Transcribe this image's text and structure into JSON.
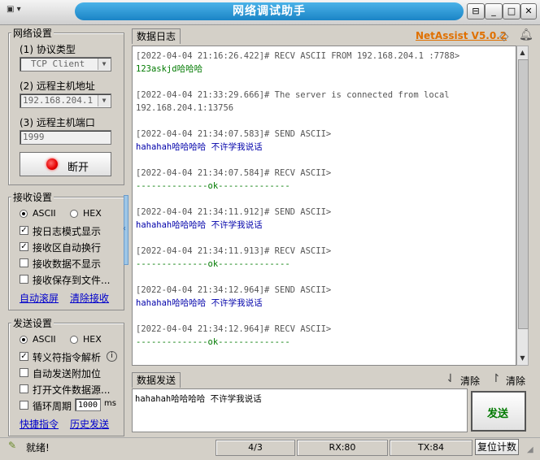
{
  "app": {
    "title": "网络调试助手",
    "brand": "NetAssist V5.0.2"
  },
  "colors": {
    "title_pill": "#2b98d6",
    "brand": "#e07000",
    "recv_text": "#007a00",
    "send_text": "#0000aa",
    "send_button": "#007a00",
    "led": "#e60000"
  },
  "network": {
    "group_title": "网络设置",
    "protocol_label": "(1) 协议类型",
    "protocol_value": "TCP Client",
    "host_label": "(2) 远程主机地址",
    "host_value": "192.168.204.1",
    "port_label": "(3) 远程主机端口",
    "port_value": "1999",
    "connect_button": "断开"
  },
  "recv_settings": {
    "group_title": "接收设置",
    "radio_ascii": "ASCII",
    "radio_hex": "HEX",
    "selected": "ASCII",
    "options": [
      {
        "label": "按日志模式显示",
        "checked": true
      },
      {
        "label": "接收区自动换行",
        "checked": true
      },
      {
        "label": "接收数据不显示",
        "checked": false
      },
      {
        "label": "接收保存到文件...",
        "checked": false
      }
    ],
    "link_autoscroll": "自动滚屏",
    "link_clear": "清除接收"
  },
  "send_settings": {
    "group_title": "发送设置",
    "radio_ascii": "ASCII",
    "radio_hex": "HEX",
    "selected": "ASCII",
    "options": [
      {
        "label": "转义符指令解析",
        "checked": true
      },
      {
        "label": "自动发送附加位",
        "checked": false
      },
      {
        "label": "打开文件数据源...",
        "checked": false
      },
      {
        "label": "循环周期",
        "checked": false
      }
    ],
    "cycle_value": "1000",
    "cycle_unit": "ms",
    "link_shortcut": "快捷指令",
    "link_history": "历史发送"
  },
  "log": {
    "tab": "数据日志",
    "entries": [
      {
        "meta": "[2022-04-04 21:16:26.422]# RECV ASCII FROM 192.168.204.1 :7788>",
        "body": "123askjd哈哈哈",
        "kind": "recv"
      },
      {
        "meta": "[2022-04-04 21:33:29.666]# The server is connected from local",
        "body": "192.168.204.1:13756",
        "kind": "meta"
      },
      {
        "meta": "[2022-04-04 21:34:07.583]# SEND ASCII>",
        "body": "hahahah哈哈哈哈 不许学我说话",
        "kind": "send"
      },
      {
        "meta": "[2022-04-04 21:34:07.584]# RECV ASCII>",
        "body": "--------------ok--------------",
        "kind": "recv"
      },
      {
        "meta": "[2022-04-04 21:34:11.912]# SEND ASCII>",
        "body": "hahahah哈哈哈哈 不许学我说话",
        "kind": "send"
      },
      {
        "meta": "[2022-04-04 21:34:11.913]# RECV ASCII>",
        "body": "--------------ok--------------",
        "kind": "recv"
      },
      {
        "meta": "[2022-04-04 21:34:12.964]# SEND ASCII>",
        "body": "hahahah哈哈哈哈 不许学我说话",
        "kind": "send"
      },
      {
        "meta": "[2022-04-04 21:34:12.964]# RECV ASCII>",
        "body": "--------------ok--------------",
        "kind": "recv"
      }
    ]
  },
  "send_area": {
    "tab": "数据发送",
    "clear1": "清除",
    "clear2": "清除",
    "text": "hahahah哈哈哈哈 不许学我说话",
    "send_button": "发送"
  },
  "status": {
    "text": "就绪!",
    "count": "4/3",
    "rx": "RX:80",
    "tx": "TX:84",
    "reset": "复位计数"
  }
}
